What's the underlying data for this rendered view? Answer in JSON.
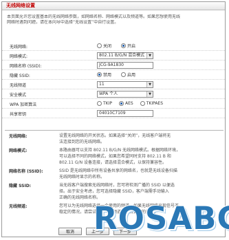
{
  "title": "无线网络设置",
  "intro_lines": [
    "本页面允许您设置基本的无线网络参数，如网络名称、网络模式以及频道等。如果您想使用无线",
    "网络时遇到问题，请在本向导中选择“无线设置”中自行设置。"
  ],
  "form": {
    "wireless_switch": {
      "label": "无线网络:",
      "options": [
        "关闭",
        "开启"
      ],
      "selected": 1
    },
    "network_mode": {
      "label": "网络模式:",
      "value": "802.11 B/G/N 混合模式"
    },
    "ssid": {
      "label": "网络名称 (SSID):",
      "value": "JCG-9A1830"
    },
    "hide_ssid": {
      "label": "隐藏 SSID:",
      "options": [
        "禁用",
        "启用"
      ],
      "selected": 0
    },
    "channel": {
      "label": "无线频道",
      "value": "11"
    },
    "security_mode": {
      "label": "安全模式",
      "value": "WPA 个人"
    },
    "wpa_algorithm": {
      "label": "WPA 加密算法",
      "options": [
        "TKIP",
        "AES",
        "TKIPAES"
      ],
      "selected": 1
    },
    "shared_key": {
      "label": "共享密钥",
      "value": "04010C7109"
    }
  },
  "help": [
    {
      "label": "无线网络:",
      "lines": [
        "设置无线网络的开关状态。如果选择“关闭”，无线客户端将无",
        "法连接到您的无线网络。"
      ]
    },
    {
      "label": "网络模式:",
      "lines": [
        "本路由器可以支持 802.11 B/G/N 无线网络模式。根据网络环境，",
        "可以选择不同的网络模式，如果您希望同时支持 802.11 B 和",
        "802.11 G/N 设备连接，请选择混合模式，以保持兼容性。"
      ]
    },
    {
      "label": "网络名称 (SSID):",
      "lines": [
        "SSID 是无线网络中所有设备共享的网络名，也就是无线设备扫描",
        "无线网络时显示的名称。"
      ]
    },
    {
      "label": "隐藏 SSID:",
      "lines": [
        "当无线客户端搜索无线网络时，您可将检测广播的 SSID 以便选",
        "择。出于安全考虑，您可选择隐藏 SSID，客户端需手动输入",
        "正确的无线网络名称。"
      ]
    },
    {
      "label": "无线频道:",
      "lines": [
        "您可以为无线网络选择一个使用的频道，如果无线网络出现信号不",
        "稳定的情况，请尝试更换一个频道以获得更好的效果。"
      ]
    }
  ],
  "buttons": {
    "cancel": "取消",
    "prev": "上一步",
    "next": "下一步"
  },
  "watermark": "ROSABC",
  "colors": {
    "title": "#c00000",
    "watermark": "#2a78b6"
  }
}
